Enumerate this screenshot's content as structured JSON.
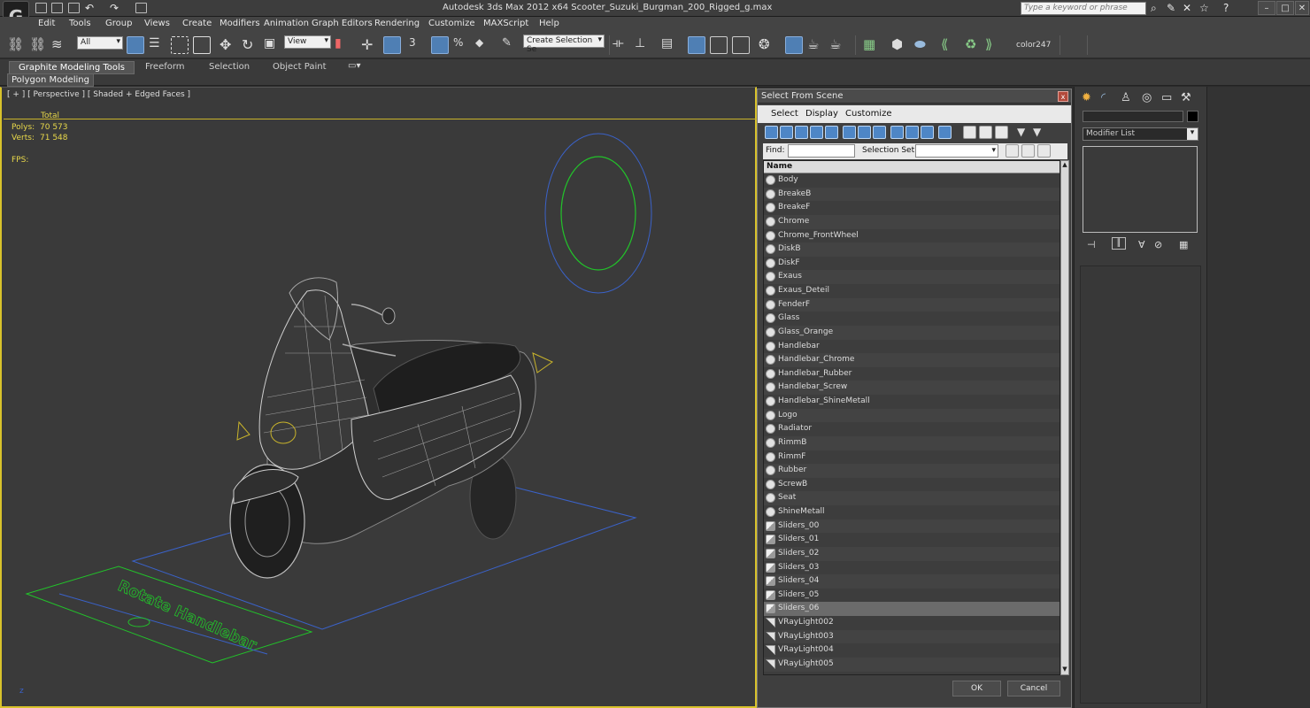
{
  "app": {
    "logo": "G",
    "title": "Autodesk 3ds Max  2012 x64      Scooter_Suzuki_Burgman_200_Rigged_g.max",
    "search_placeholder": "Type a keyword or phrase"
  },
  "menu": [
    "Edit",
    "Tools",
    "Group",
    "Views",
    "Create",
    "Modifiers",
    "Animation",
    "Graph Editors",
    "Rendering",
    "Customize",
    "MAXScript",
    "Help"
  ],
  "toolbar": {
    "filter": "All",
    "ref_coord": "View",
    "selection_set": "Create Selection Se",
    "color_label": "color247",
    "snap_label": "3"
  },
  "ribbon": {
    "tabs": [
      "Graphite Modeling Tools",
      "Freeform",
      "Selection",
      "Object Paint"
    ],
    "active_tab": 0,
    "sub_tab": "Polygon Modeling"
  },
  "viewport": {
    "label": "[ + ] [ Perspective ] [ Shaded + Edged Faces ]",
    "stats": {
      "total_label": "Total",
      "polys_label": "Polys:",
      "polys": "70 573",
      "verts_label": "Verts:",
      "verts": "71 548",
      "fps_label": "FPS:"
    },
    "ground_text": "Rotate Handlebar",
    "colors": {
      "wire": "#cfcfcf",
      "body": "#2e2e2e",
      "green": "#22c22a",
      "blue": "#3a62c9",
      "yellow": "#d8c22b"
    }
  },
  "dialog": {
    "title": "Select From Scene",
    "close": "x",
    "menu": [
      "Select",
      "Display",
      "Customize"
    ],
    "find_label": "Find:",
    "selset_label": "Selection Set:",
    "column": "Name",
    "items": [
      {
        "name": "Body",
        "kind": "geo"
      },
      {
        "name": "BreakeB",
        "kind": "geo"
      },
      {
        "name": "BreakeF",
        "kind": "geo"
      },
      {
        "name": "Chrome",
        "kind": "geo"
      },
      {
        "name": "Chrome_FrontWheel",
        "kind": "geo"
      },
      {
        "name": "DiskB",
        "kind": "geo"
      },
      {
        "name": "DiskF",
        "kind": "geo"
      },
      {
        "name": "Exaus",
        "kind": "geo"
      },
      {
        "name": "Exaus_Deteil",
        "kind": "geo"
      },
      {
        "name": "FenderF",
        "kind": "geo"
      },
      {
        "name": "Glass",
        "kind": "geo"
      },
      {
        "name": "Glass_Orange",
        "kind": "geo"
      },
      {
        "name": "Handlebar",
        "kind": "geo"
      },
      {
        "name": "Handlebar_Chrome",
        "kind": "geo"
      },
      {
        "name": "Handlebar_Rubber",
        "kind": "geo"
      },
      {
        "name": "Handlebar_Screw",
        "kind": "geo"
      },
      {
        "name": "Handlebar_ShineMetall",
        "kind": "geo"
      },
      {
        "name": "Logo",
        "kind": "geo"
      },
      {
        "name": "Radiator",
        "kind": "geo"
      },
      {
        "name": "RimmB",
        "kind": "geo"
      },
      {
        "name": "RimmF",
        "kind": "geo"
      },
      {
        "name": "Rubber",
        "kind": "geo"
      },
      {
        "name": "ScrewB",
        "kind": "geo"
      },
      {
        "name": "Seat",
        "kind": "geo"
      },
      {
        "name": "ShineMetall",
        "kind": "geo"
      },
      {
        "name": "Sliders_00",
        "kind": "shape"
      },
      {
        "name": "Sliders_01",
        "kind": "shape"
      },
      {
        "name": "Sliders_02",
        "kind": "shape"
      },
      {
        "name": "Sliders_03",
        "kind": "shape"
      },
      {
        "name": "Sliders_04",
        "kind": "shape"
      },
      {
        "name": "Sliders_05",
        "kind": "shape"
      },
      {
        "name": "Sliders_06",
        "kind": "shape",
        "selected": true
      },
      {
        "name": "VRayLight002",
        "kind": "light"
      },
      {
        "name": "VRayLight003",
        "kind": "light"
      },
      {
        "name": "VRayLight004",
        "kind": "light"
      },
      {
        "name": "VRayLight005",
        "kind": "light"
      }
    ],
    "ok": "OK",
    "cancel": "Cancel"
  },
  "command_panel": {
    "modifier_list": "Modifier List"
  }
}
